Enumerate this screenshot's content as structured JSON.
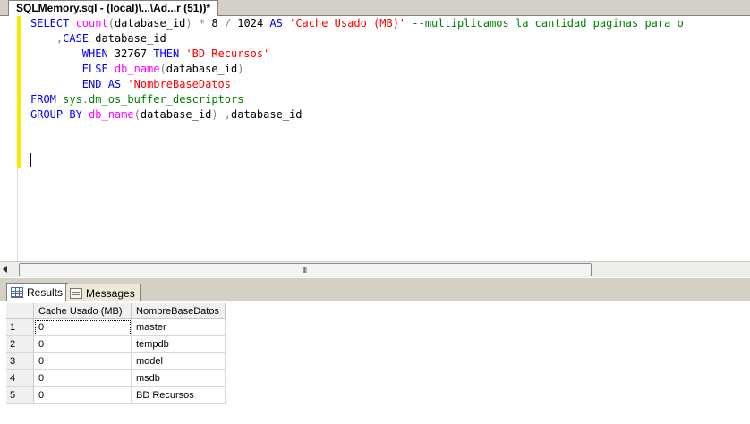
{
  "document_tab": {
    "title": "SQLMemory.sql - (local)\\...\\Ad...r (51))*"
  },
  "editor": {
    "lines": [
      [
        {
          "t": "SELECT ",
          "c": "kw"
        },
        {
          "t": "count",
          "c": "fn"
        },
        {
          "t": "(",
          "c": "op"
        },
        {
          "t": "database_id",
          "c": ""
        },
        {
          "t": ")",
          "c": "op"
        },
        {
          "t": " ",
          "c": ""
        },
        {
          "t": "*",
          "c": "op"
        },
        {
          "t": " 8 ",
          "c": ""
        },
        {
          "t": "/",
          "c": "op"
        },
        {
          "t": " 1024 ",
          "c": ""
        },
        {
          "t": "AS ",
          "c": "kw"
        },
        {
          "t": "'Cache Usado (MB)'",
          "c": "str"
        },
        {
          "t": " ",
          "c": ""
        },
        {
          "t": "--multiplicamos la cantidad paginas para o",
          "c": "cm"
        }
      ],
      [
        {
          "t": "    ",
          "c": ""
        },
        {
          "t": ",",
          "c": "op"
        },
        {
          "t": "CASE ",
          "c": "kw"
        },
        {
          "t": "database_id",
          "c": ""
        }
      ],
      [
        {
          "t": "        ",
          "c": ""
        },
        {
          "t": "WHEN ",
          "c": "kw"
        },
        {
          "t": "32767 ",
          "c": ""
        },
        {
          "t": "THEN ",
          "c": "kw"
        },
        {
          "t": "'BD Recursos'",
          "c": "str"
        }
      ],
      [
        {
          "t": "        ",
          "c": ""
        },
        {
          "t": "ELSE ",
          "c": "kw"
        },
        {
          "t": "db_name",
          "c": "fn"
        },
        {
          "t": "(",
          "c": "op"
        },
        {
          "t": "database_id",
          "c": ""
        },
        {
          "t": ")",
          "c": "op"
        }
      ],
      [
        {
          "t": "        ",
          "c": ""
        },
        {
          "t": "END ",
          "c": "kw"
        },
        {
          "t": "AS ",
          "c": "kw"
        },
        {
          "t": "'NombreBaseDatos'",
          "c": "str"
        }
      ],
      [
        {
          "t": "FROM ",
          "c": "kw"
        },
        {
          "t": "sys",
          "c": "cm"
        },
        {
          "t": ".",
          "c": "op"
        },
        {
          "t": "dm_os_buffer_descriptors",
          "c": "cm"
        }
      ],
      [
        {
          "t": "GROUP BY ",
          "c": "kw"
        },
        {
          "t": "db_name",
          "c": "fn"
        },
        {
          "t": "(",
          "c": "op"
        },
        {
          "t": "database_id",
          "c": ""
        },
        {
          "t": ")",
          "c": "op"
        },
        {
          "t": " ",
          "c": ""
        },
        {
          "t": ",",
          "c": "op"
        },
        {
          "t": "database_id",
          "c": ""
        }
      ]
    ]
  },
  "scrollbar": {
    "grip": "III"
  },
  "results_tabs": {
    "results_label": "Results",
    "messages_label": "Messages"
  },
  "results_grid": {
    "columns": [
      "Cache Usado (MB)",
      "NombreBaseDatos"
    ],
    "rows": [
      {
        "n": "1",
        "cache": "0",
        "name": "master"
      },
      {
        "n": "2",
        "cache": "0",
        "name": "tempdb"
      },
      {
        "n": "3",
        "cache": "0",
        "name": "model"
      },
      {
        "n": "4",
        "cache": "0",
        "name": "msdb"
      },
      {
        "n": "5",
        "cache": "0",
        "name": "BD Recursos"
      }
    ]
  },
  "colors": {
    "keyword": "#0000ff",
    "function": "#ff00ff",
    "string": "#ff0000",
    "comment_and_sysobject": "#008000",
    "operator": "#808080",
    "change_marker": "#ffe600"
  }
}
